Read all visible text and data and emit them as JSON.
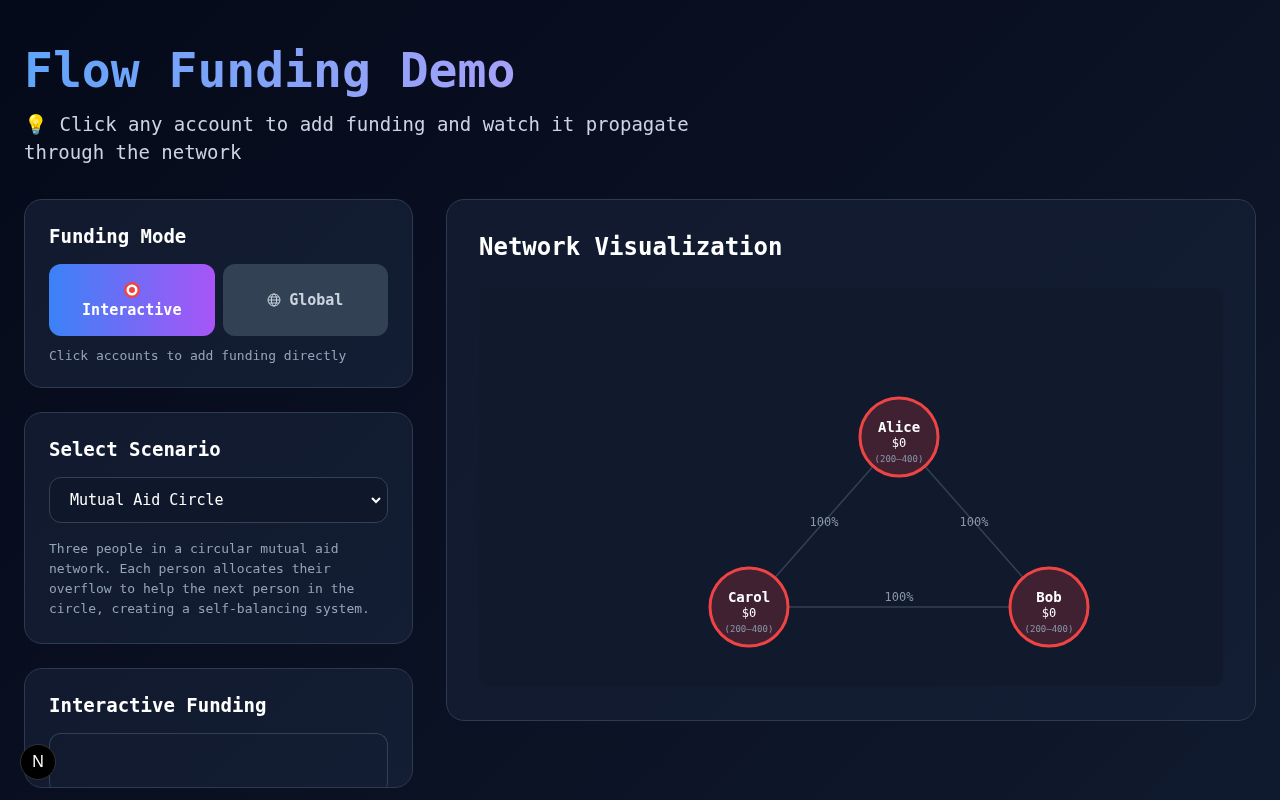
{
  "header": {
    "title": "Flow Funding Demo",
    "subtitle": "💡 Click any account to add funding and watch it propagate through the network"
  },
  "funding_mode": {
    "title": "Funding Mode",
    "modes": [
      {
        "label": "Interactive",
        "selected": true
      },
      {
        "label": "Global",
        "selected": false
      }
    ],
    "help": "Click accounts to add funding directly"
  },
  "scenario": {
    "title": "Select Scenario",
    "value": "Mutual Aid Circle",
    "description": "Three people in a circular mutual aid network. Each person allocates their overflow to help the next person in the circle, creating a self-balancing system."
  },
  "interactive_funding": {
    "title": "Interactive Funding"
  },
  "network": {
    "title": "Network Visualization",
    "nodes": [
      {
        "name": "Alice",
        "amount": "$0",
        "range": "(200–400)"
      },
      {
        "name": "Carol",
        "amount": "$0",
        "range": "(200–400)"
      },
      {
        "name": "Bob",
        "amount": "$0",
        "range": "(200–400)"
      }
    ],
    "edges": [
      {
        "label": "100%"
      },
      {
        "label": "100%"
      },
      {
        "label": "100%"
      }
    ]
  },
  "dev_badge": {
    "label": "N"
  }
}
